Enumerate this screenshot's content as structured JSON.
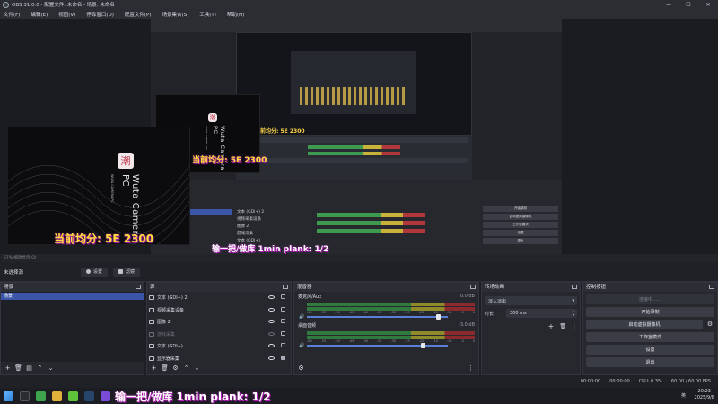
{
  "window": {
    "title": "OBS 31.0.0 - 配置文件: 未命名 - 场景: 未命名",
    "controls": [
      "—",
      "☐",
      "✕"
    ]
  },
  "menu": [
    "文件(F)",
    "编辑(E)",
    "视图(V)",
    "停靠窗口(D)",
    "配置文件(P)",
    "场景集合(S)",
    "工具(T)",
    "帮助(H)"
  ],
  "preview": {
    "score_text": "当前均分: 5E 2300",
    "plank_text": "输一把/做库 1min plank: 1/2",
    "wuta_title": "Wuta Camera PC",
    "wuta_subtitle": "WUTA CAMERA PC",
    "wuta_logo": "潮",
    "zoom_text": "57%  缩放显示(Q)"
  },
  "scene_bar": {
    "label": "未选择源",
    "properties": "设置",
    "filters": "滤镜"
  },
  "scenes": {
    "title": "场景",
    "items": [
      "场景"
    ]
  },
  "sources": {
    "title": "源",
    "items": [
      {
        "icon": "cloud-icon",
        "label": "文本 (GDI+) 2",
        "visible": true
      },
      {
        "icon": "camera-icon",
        "label": "视频采集设备",
        "visible": true
      },
      {
        "icon": "image-icon",
        "label": "图像 2",
        "visible": true
      },
      {
        "icon": "game-icon",
        "label": "游戏采集",
        "visible": false
      },
      {
        "icon": "cloud-icon",
        "label": "文本 (GDI+)",
        "visible": true
      },
      {
        "icon": "monitor-icon",
        "label": "显示器采集",
        "visible": true
      }
    ]
  },
  "mixer": {
    "title": "混音器",
    "channels": [
      {
        "name": "麦克风/Aux",
        "db": "0.0 dB",
        "level": 0.93
      },
      {
        "name": "桌面音频",
        "db": "-3.0 dB",
        "level": 0.82
      }
    ],
    "ticks": [
      "-60",
      "-55",
      "-50",
      "-45",
      "-40",
      "-35",
      "-30",
      "-25",
      "-20",
      "-15",
      "-10",
      "-5",
      "0"
    ]
  },
  "transitions": {
    "title": "转场动画",
    "selected": "淡入淡出",
    "duration_label": "时长",
    "duration": "300 ms"
  },
  "controls": {
    "title": "控制按钮",
    "buttons": {
      "stream": "连接中……",
      "record": "开始录制",
      "virtualcam": "启动虚拟摄像机",
      "studio": "工作室模式",
      "settings": "设置",
      "exit": "退出"
    }
  },
  "status": {
    "time1": "00:00:00",
    "time2": "00:00:00",
    "cpu": "CPU: 0.3%",
    "fps": "60.00 / 60.00 FPS"
  },
  "taskbar": {
    "clock": "20:23",
    "date": "2025/9/8",
    "lang": "英"
  },
  "colors": {
    "accent": "#3b56a8",
    "meter_green": "#2f7a3c",
    "meter_yellow": "#8f8a2a",
    "meter_red": "#8a2a2d",
    "overlay_yellow": "#ffe03a"
  }
}
